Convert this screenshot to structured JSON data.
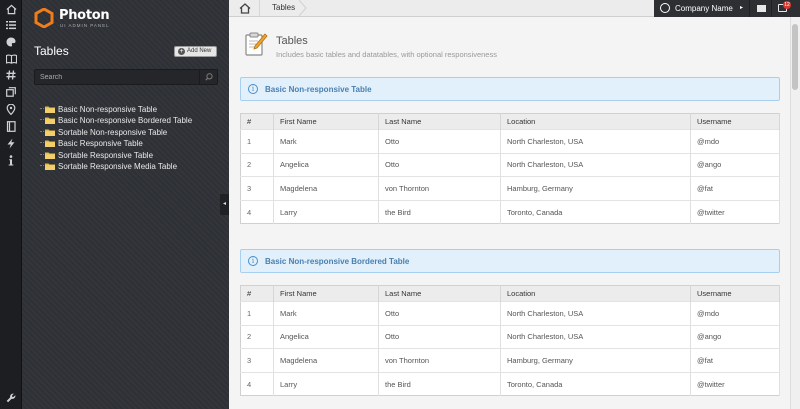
{
  "brand": {
    "name": "Photon",
    "tagline": "UI ADMIN PANEL",
    "accent": "#f07d1a"
  },
  "rail_icons": [
    "home-icon",
    "list-icon",
    "palette-icon",
    "book-icon",
    "hashtag-icon",
    "windows-icon",
    "map-pin-icon",
    "notebook-icon",
    "lightning-icon",
    "info-icon",
    "wrench-icon"
  ],
  "sidebar": {
    "title": "Tables",
    "add_label": "Add New",
    "search_placeholder": "Search",
    "items": [
      {
        "label": "Basic Non-responsive Table"
      },
      {
        "label": "Basic Non-responsive Bordered Table"
      },
      {
        "label": "Sortable Non-responsive Table"
      },
      {
        "label": "Basic Responsive Table"
      },
      {
        "label": "Sortable Responsive Table"
      },
      {
        "label": "Sortable Responsive Media Table"
      }
    ]
  },
  "topbar": {
    "breadcrumb": "Tables",
    "company": "Company Name",
    "notifications": "12"
  },
  "page": {
    "title": "Tables",
    "subtitle": "Includes basic tables and datatables, with optional responsiveness"
  },
  "sections": [
    {
      "title": "Basic Non-responsive Table",
      "columns": [
        "#",
        "First Name",
        "Last Name",
        "Location",
        "Username"
      ],
      "rows": [
        [
          "1",
          "Mark",
          "Otto",
          "North Charleston, USA",
          "@mdo"
        ],
        [
          "2",
          "Angelica",
          "Otto",
          "North Charleston, USA",
          "@ango"
        ],
        [
          "3",
          "Magdelena",
          "von Thornton",
          "Hamburg, Germany",
          "@fat"
        ],
        [
          "4",
          "Larry",
          "the Bird",
          "Toronto, Canada",
          "@twitter"
        ]
      ]
    },
    {
      "title": "Basic Non-responsive Bordered Table",
      "columns": [
        "#",
        "First Name",
        "Last Name",
        "Location",
        "Username"
      ],
      "rows": [
        [
          "1",
          "Mark",
          "Otto",
          "North Charleston, USA",
          "@mdo"
        ],
        [
          "2",
          "Angelica",
          "Otto",
          "North Charleston, USA",
          "@ango"
        ],
        [
          "3",
          "Magdelena",
          "von Thornton",
          "Hamburg, Germany",
          "@fat"
        ],
        [
          "4",
          "Larry",
          "the Bird",
          "Toronto, Canada",
          "@twitter"
        ]
      ]
    }
  ]
}
